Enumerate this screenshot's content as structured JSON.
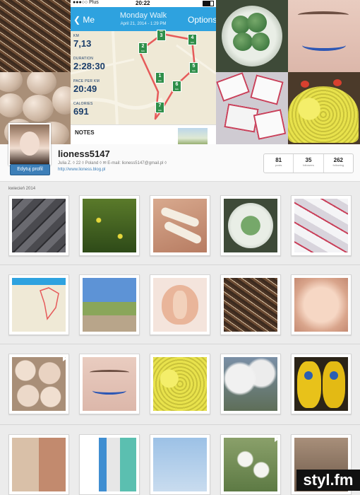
{
  "phone": {
    "carrier": "Plus",
    "time": "20:22",
    "back_label": "Me",
    "title": "Monday Walk",
    "date": "April 21, 2014 - 1:29 PM",
    "options_label": "Options",
    "stats": [
      {
        "label": "KM",
        "value": "7,13"
      },
      {
        "label": "DURATION",
        "value": "2:28:30"
      },
      {
        "label": "PACE PER KM",
        "value": "20:49"
      },
      {
        "label": "CALORIES",
        "value": "691"
      }
    ],
    "km_markers": [
      "1",
      "2",
      "3",
      "4",
      "5",
      "6",
      "7"
    ],
    "notes_label": "NOTES"
  },
  "profile": {
    "username": "lioness5147",
    "edit_button": "Edytuj profil",
    "bio": "Julia Z. ◊ 22 ◊ Poland ◊ ✉ E-mail: lioness5147@gmail.pl ◊",
    "link": "http://www.lioness.blog.pl",
    "stats": [
      {
        "count": "81",
        "label": "posts"
      },
      {
        "count": "35",
        "label": "followers"
      },
      {
        "count": "262",
        "label": "following"
      }
    ]
  },
  "month_label": "kwiecień 2014",
  "watermark": "styl.fm"
}
